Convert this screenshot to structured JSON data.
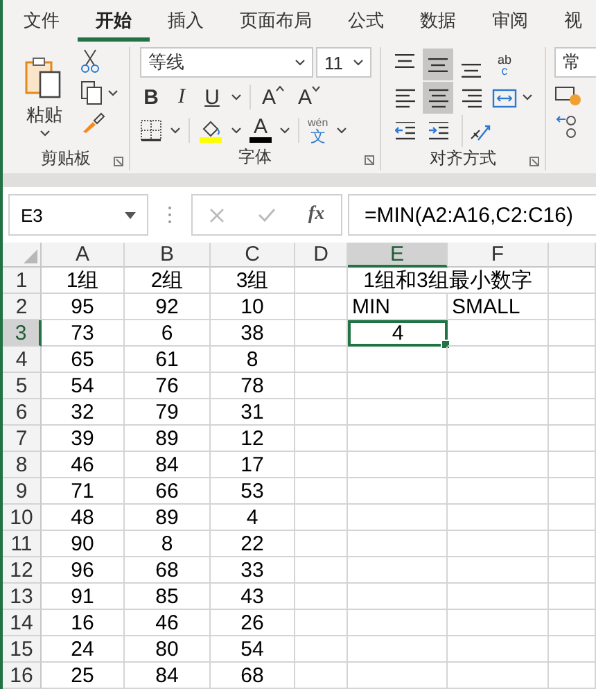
{
  "tabs": [
    {
      "label": "文件",
      "selected": false
    },
    {
      "label": "开始",
      "selected": true
    },
    {
      "label": "插入",
      "selected": false
    },
    {
      "label": "页面布局",
      "selected": false
    },
    {
      "label": "公式",
      "selected": false
    },
    {
      "label": "数据",
      "selected": false
    },
    {
      "label": "审阅",
      "selected": false
    },
    {
      "label": "视",
      "selected": false
    }
  ],
  "ribbon": {
    "clipboard": {
      "paste": "粘贴",
      "group_label": "剪贴板"
    },
    "font": {
      "font_name": "等线",
      "font_size": "11",
      "bold": "B",
      "italic": "I",
      "underline": "U",
      "grow": "A",
      "shrink": "A",
      "font_color": "A",
      "phonetic_top": "wén",
      "phonetic_bottom": "文",
      "group_label": "字体"
    },
    "alignment": {
      "buttons": [
        {
          "kind": "top",
          "selected": false
        },
        {
          "kind": "middle",
          "selected": true
        },
        {
          "kind": "bottom",
          "selected": false
        },
        {
          "kind": "wrap",
          "selected": false
        },
        {
          "kind": "left",
          "selected": false
        },
        {
          "kind": "center",
          "selected": true
        },
        {
          "kind": "right",
          "selected": false
        },
        {
          "kind": "merge",
          "selected": false
        },
        {
          "kind": "outdent",
          "selected": false
        },
        {
          "kind": "indent",
          "selected": false
        },
        {
          "kind": "orient",
          "selected": false
        }
      ],
      "wrap_label": "ab",
      "wrap_label_2": "c",
      "group_label": "对齐方式"
    },
    "number": {
      "format": "常"
    }
  },
  "name_box": "E3",
  "formula_bar": {
    "fx": "fx",
    "formula": "=MIN(A2:A16,C2:C16)"
  },
  "sheet": {
    "columns": [
      {
        "label": "A",
        "selected": false
      },
      {
        "label": "B",
        "selected": false
      },
      {
        "label": "C",
        "selected": false
      },
      {
        "label": "D",
        "selected": false
      },
      {
        "label": "E",
        "selected": true
      },
      {
        "label": "F",
        "selected": false
      }
    ],
    "rows": [
      {
        "label": "1",
        "selected": false,
        "cells": {
          "A": {
            "text": "1组",
            "selected": false
          },
          "B": {
            "text": "2组",
            "selected": false
          },
          "C": {
            "text": "3组",
            "selected": false
          },
          "E": {
            "text": "1组和3组最小数字",
            "selected": false,
            "merged_across": true
          }
        }
      },
      {
        "label": "2",
        "selected": false,
        "cells": {
          "A": {
            "text": "95",
            "selected": false
          },
          "B": {
            "text": "92",
            "selected": false
          },
          "C": {
            "text": "10",
            "selected": false
          },
          "E": {
            "text": "MIN",
            "selected": false,
            "left_aligned": true
          },
          "F": {
            "text": "SMALL",
            "selected": false,
            "left_aligned": true
          }
        }
      },
      {
        "label": "3",
        "selected": true,
        "cells": {
          "A": {
            "text": "73",
            "selected": false
          },
          "B": {
            "text": "6",
            "selected": false
          },
          "C": {
            "text": "38",
            "selected": false
          },
          "E": {
            "text": "4",
            "selected": true
          }
        }
      },
      {
        "label": "4",
        "selected": false,
        "cells": {
          "A": {
            "text": "65",
            "selected": false
          },
          "B": {
            "text": "61",
            "selected": false
          },
          "C": {
            "text": "8",
            "selected": false
          }
        }
      },
      {
        "label": "5",
        "selected": false,
        "cells": {
          "A": {
            "text": "54",
            "selected": false
          },
          "B": {
            "text": "76",
            "selected": false
          },
          "C": {
            "text": "78",
            "selected": false
          }
        }
      },
      {
        "label": "6",
        "selected": false,
        "cells": {
          "A": {
            "text": "32",
            "selected": false
          },
          "B": {
            "text": "79",
            "selected": false
          },
          "C": {
            "text": "31",
            "selected": false
          }
        }
      },
      {
        "label": "7",
        "selected": false,
        "cells": {
          "A": {
            "text": "39",
            "selected": false
          },
          "B": {
            "text": "89",
            "selected": false
          },
          "C": {
            "text": "12",
            "selected": false
          }
        }
      },
      {
        "label": "8",
        "selected": false,
        "cells": {
          "A": {
            "text": "46",
            "selected": false
          },
          "B": {
            "text": "84",
            "selected": false
          },
          "C": {
            "text": "17",
            "selected": false
          }
        }
      },
      {
        "label": "9",
        "selected": false,
        "cells": {
          "A": {
            "text": "71",
            "selected": false
          },
          "B": {
            "text": "66",
            "selected": false
          },
          "C": {
            "text": "53",
            "selected": false
          }
        }
      },
      {
        "label": "10",
        "selected": false,
        "cells": {
          "A": {
            "text": "48",
            "selected": false
          },
          "B": {
            "text": "89",
            "selected": false
          },
          "C": {
            "text": "4",
            "selected": false
          }
        }
      },
      {
        "label": "11",
        "selected": false,
        "cells": {
          "A": {
            "text": "90",
            "selected": false
          },
          "B": {
            "text": "8",
            "selected": false
          },
          "C": {
            "text": "22",
            "selected": false
          }
        }
      },
      {
        "label": "12",
        "selected": false,
        "cells": {
          "A": {
            "text": "96",
            "selected": false
          },
          "B": {
            "text": "68",
            "selected": false
          },
          "C": {
            "text": "33",
            "selected": false
          }
        }
      },
      {
        "label": "13",
        "selected": false,
        "cells": {
          "A": {
            "text": "91",
            "selected": false
          },
          "B": {
            "text": "85",
            "selected": false
          },
          "C": {
            "text": "43",
            "selected": false
          }
        }
      },
      {
        "label": "14",
        "selected": false,
        "cells": {
          "A": {
            "text": "16",
            "selected": false
          },
          "B": {
            "text": "46",
            "selected": false
          },
          "C": {
            "text": "26",
            "selected": false
          }
        }
      },
      {
        "label": "15",
        "selected": false,
        "cells": {
          "A": {
            "text": "24",
            "selected": false
          },
          "B": {
            "text": "80",
            "selected": false
          },
          "C": {
            "text": "54",
            "selected": false
          }
        }
      },
      {
        "label": "16",
        "selected": false,
        "cells": {
          "A": {
            "text": "25",
            "selected": false
          },
          "B": {
            "text": "84",
            "selected": false
          },
          "C": {
            "text": "68",
            "selected": false
          }
        }
      }
    ]
  }
}
